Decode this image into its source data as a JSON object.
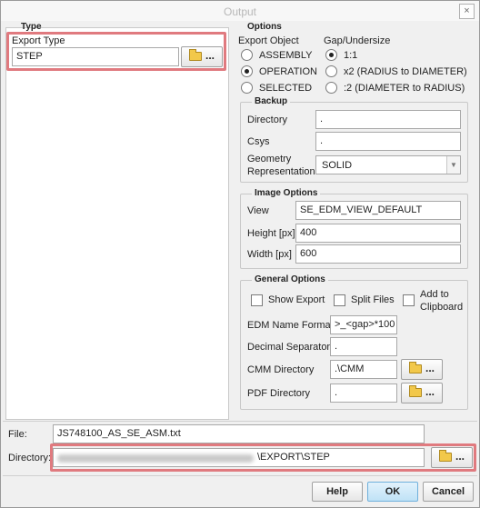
{
  "window": {
    "title": "Output",
    "close": "×"
  },
  "type_group": {
    "title": "Type",
    "export_type_label": "Export Type",
    "export_type_value": "STEP",
    "browse": "..."
  },
  "options": {
    "title": "Options",
    "export_object_label": "Export Object",
    "export_objects": [
      "ASSEMBLY",
      "OPERATION",
      "SELECTED"
    ],
    "export_object_selected": 1,
    "gap_label": "Gap/Undersize",
    "gaps": [
      "1:1",
      "x2 (RADIUS to DIAMETER)",
      ":2 (DIAMETER to RADIUS)"
    ],
    "gap_selected": 0
  },
  "backup": {
    "title": "Backup",
    "directory_label": "Directory",
    "directory_value": ".",
    "csys_label": "Csys",
    "csys_value": ".",
    "geometry_label_1": "Geometry",
    "geometry_label_2": "Representation",
    "geometry_value": "SOLID",
    "geometry_arrow": "▼"
  },
  "image_options": {
    "title": "Image Options",
    "view_label": "View",
    "view_value": "SE_EDM_VIEW_DEFAULT",
    "height_label": "Height [px]",
    "height_value": "400",
    "width_label": "Width [px]",
    "width_value": "600"
  },
  "general_options": {
    "title": "General Options",
    "show_export": "Show Export",
    "split_files": "Split Files",
    "add_clipboard_1": "Add to",
    "add_clipboard_2": "Clipboard",
    "edm_name_format_label": "EDM Name Format",
    "edm_name_format_value": ">_<gap>*100",
    "decimal_separator_label": "Decimal Separator",
    "decimal_separator_value": ".",
    "cmm_directory_label": "CMM Directory",
    "cmm_directory_value": ".\\CMM",
    "pdf_directory_label": "PDF Directory",
    "pdf_directory_value": ".",
    "browse": "..."
  },
  "file": {
    "label": "File:",
    "value": "JS748100_AS_SE_ASM.txt"
  },
  "directory": {
    "label": "Directory:",
    "value_suffix": "\\EXPORT\\STEP",
    "browse": "..."
  },
  "buttons": {
    "help": "Help",
    "ok": "OK",
    "cancel": "Cancel"
  },
  "colors": {
    "highlight": "#e07a7f",
    "ok_button": "#bfe2f6"
  }
}
